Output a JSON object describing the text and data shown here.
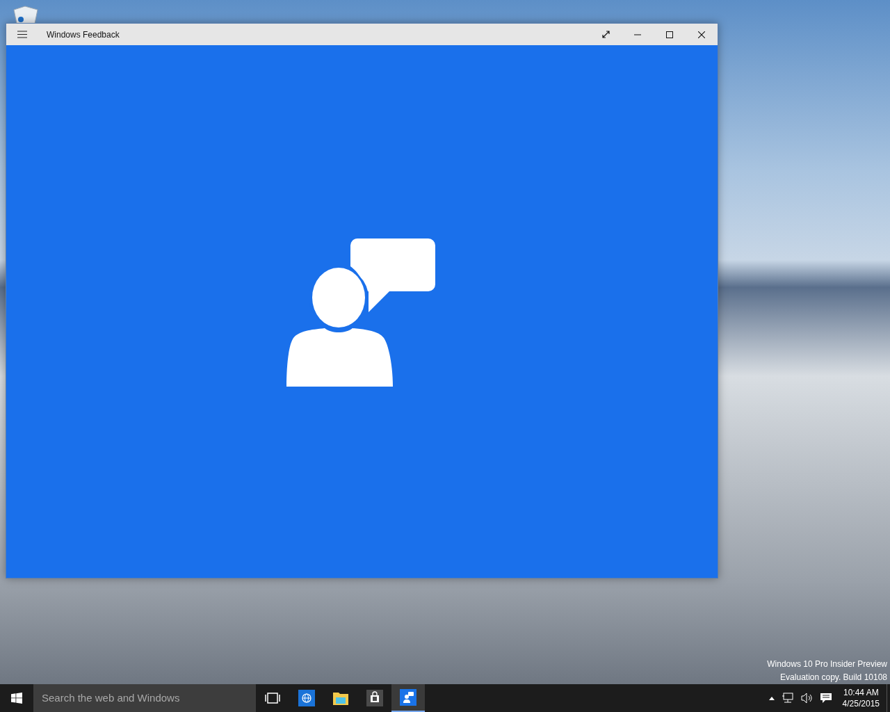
{
  "window": {
    "title": "Windows Feedback"
  },
  "desktop": {
    "build_notice": [
      "Windows 10 Pro Insider Preview",
      "Evaluation copy. Build 10108"
    ]
  },
  "taskbar": {
    "search": {
      "placeholder": "Search the web and Windows"
    },
    "apps": [
      {
        "kind": "task-view",
        "selected": false
      },
      {
        "kind": "browser",
        "selected": false
      },
      {
        "kind": "explorer",
        "selected": false
      },
      {
        "kind": "store",
        "selected": false
      },
      {
        "kind": "feedback",
        "selected": true
      }
    ],
    "clock": {
      "time": "10:44 AM",
      "date": "4/25/2015"
    }
  }
}
